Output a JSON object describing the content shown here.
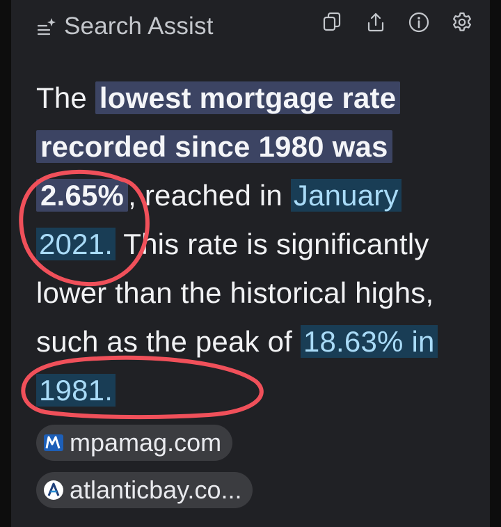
{
  "header": {
    "title": "Search Assist",
    "icons": [
      "sparkle-list-icon",
      "copy-icon",
      "share-icon",
      "info-icon",
      "gear-icon"
    ]
  },
  "answer": {
    "part1": "The ",
    "highlight_rate": "lowest mortgage rate recorded since 1980 was 2.65%",
    "part2": ", reached in ",
    "highlight_date": "January 2021.",
    "part3": " This rate is significantly lower than the historical highs, such as the peak of ",
    "highlight_peak": "18.63% in 1981."
  },
  "sources": [
    {
      "label": "mpamag.com",
      "icon": "mpa-logo-icon"
    },
    {
      "label": "atlanticbay.co...",
      "icon": "atlanticbay-logo-icon"
    }
  ],
  "colors": {
    "panel_bg": "#202125",
    "highlight_bold_bg": "#3c4463",
    "highlight_date_bg": "#193d55",
    "highlight_date_text": "#a9dbf7",
    "annotation_red": "#f0505a"
  }
}
